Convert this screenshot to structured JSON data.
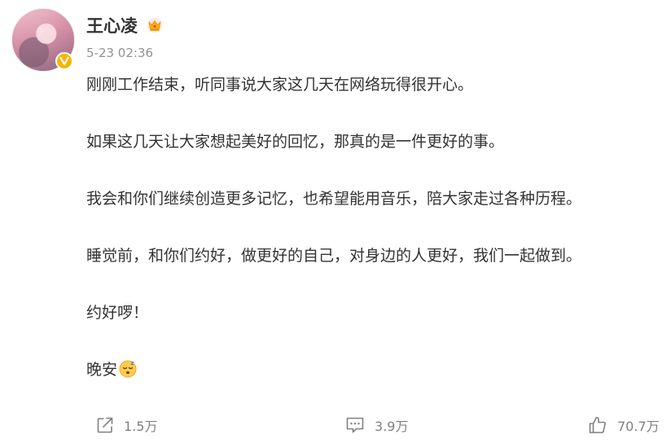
{
  "post": {
    "author": "王心凌",
    "timestamp": "5-23 02:36",
    "paragraphs": [
      "刚刚工作结束，听同事说大家这几天在网络玩得很开心。",
      "如果这几天让大家想起美好的回忆，那真的是一件更好的事。",
      "我会和你们继续创造更多记忆，也希望能用音乐，陪大家走过各种历程。",
      "睡觉前，和你们约好，做更好的自己，对身边的人更好，我们一起做到。",
      "约好啰！",
      "晚安"
    ],
    "emoji": "sleepy-face-icon"
  },
  "actions": {
    "repost_count": "1.5万",
    "comment_count": "3.9万",
    "like_count": "70.7万"
  },
  "colors": {
    "badge": "#f7b500",
    "crown": "#f7b500",
    "text": "#333333",
    "muted": "#939393",
    "icon": "#808080"
  }
}
